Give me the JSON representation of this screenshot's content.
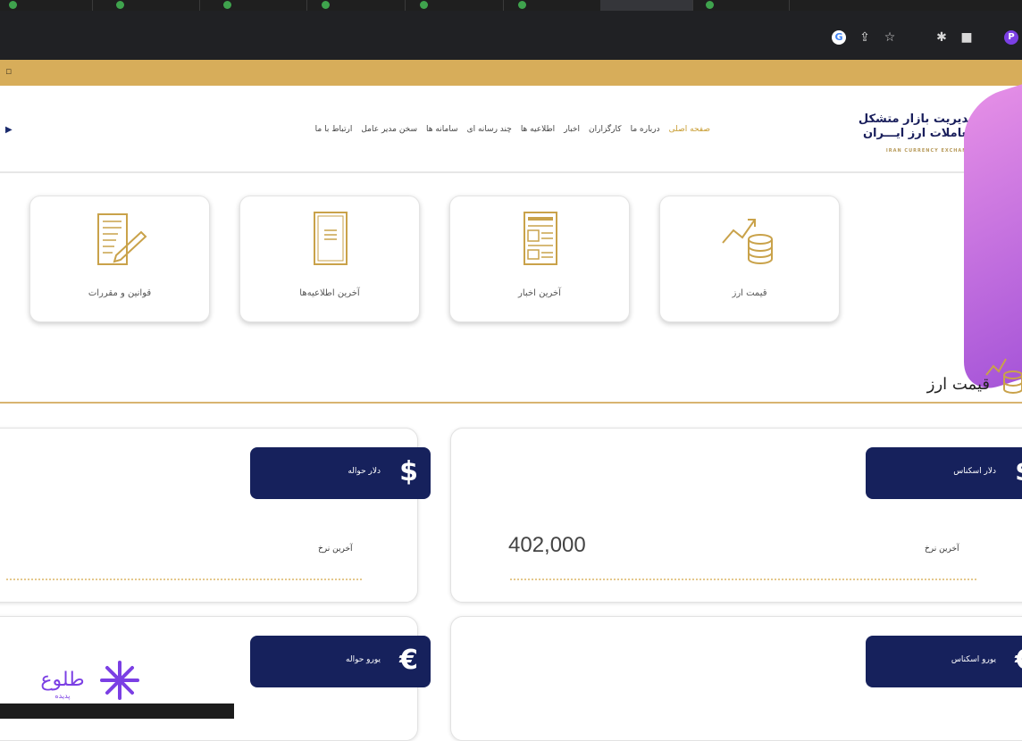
{
  "browser": {
    "tabs": [
      "",
      "",
      "",
      "",
      "",
      "",
      "",
      ""
    ],
    "profile_initial": "P",
    "google_icon": "G"
  },
  "site": {
    "logo_line1": "مدیریت بازار متشکل",
    "logo_line2": "معاملات ارز ایـــران",
    "logo_sub": "IRAN CURRENCY EXCHANGE",
    "nav": [
      "صفحه اصلی",
      "درباره ما",
      "کارگزاران",
      "اخبار",
      "اطلاعیه ها",
      "چند رسانه ای",
      "سامانه ها",
      "سخن مدیر عامل",
      "ارتباط با ما"
    ],
    "nav_active": 0
  },
  "quick_links": [
    {
      "label": "قیمت ارز",
      "icon": "coins-chart-icon"
    },
    {
      "label": "آخرین اخبار",
      "icon": "newspaper-icon"
    },
    {
      "label": "آخرین اطلاعیه‌ها",
      "icon": "document-icon"
    },
    {
      "label": "قوانین و مقررات",
      "icon": "contract-pen-icon"
    }
  ],
  "section": {
    "title": "قیمت ارز"
  },
  "rates": [
    {
      "name": "دلار اسکناس",
      "symbol": "$",
      "label": "آخرین نرخ",
      "value": "402,000"
    },
    {
      "name": "دلار حواله",
      "symbol": "$",
      "label": "آخرین نرخ",
      "value": ""
    },
    {
      "name": "یورو اسکناس",
      "symbol": "€",
      "label": "",
      "value": ""
    },
    {
      "name": "یورو حواله",
      "symbol": "€",
      "label": "",
      "value": ""
    }
  ],
  "watermark": {
    "text": "طلوع",
    "sub": "پدیده"
  },
  "colors": {
    "navy": "#16215c",
    "gold": "#c9a24a",
    "bookmark_bar": "#d7ad5a"
  }
}
